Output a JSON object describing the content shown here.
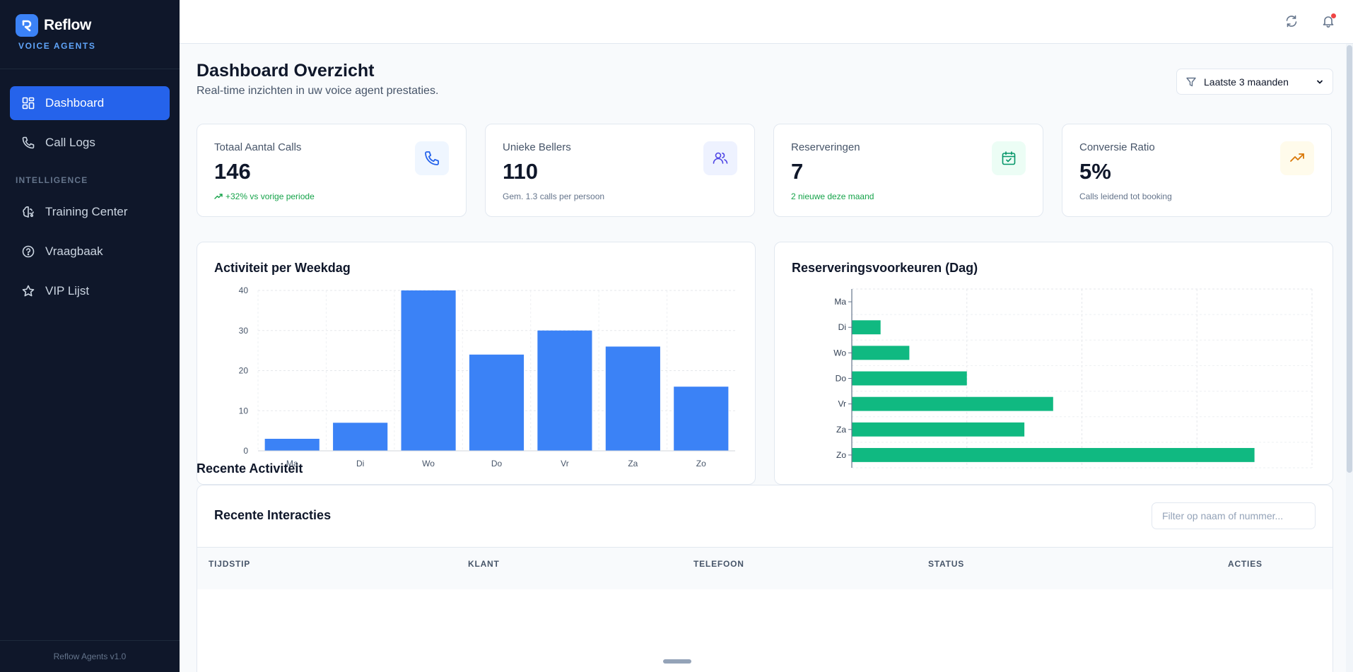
{
  "brand": {
    "name": "Reflow",
    "subtitle": "VOICE AGENTS"
  },
  "sidebar": {
    "items": [
      {
        "label": "Dashboard",
        "icon": "layout-grid-icon",
        "active": true
      },
      {
        "label": "Call Logs",
        "icon": "phone-icon",
        "active": false
      }
    ],
    "section_label": "INTELLIGENCE",
    "intel_items": [
      {
        "label": "Training Center",
        "icon": "brain-icon"
      },
      {
        "label": "Vraagbaak",
        "icon": "help-circle-icon"
      },
      {
        "label": "VIP Lijst",
        "icon": "star-icon"
      }
    ],
    "footer": "Reflow Agents v1.0"
  },
  "topbar": {
    "icons": [
      "refresh-icon",
      "bell-icon"
    ]
  },
  "header": {
    "title": "Dashboard Overzicht",
    "subtitle": "Real-time inzichten in uw voice agent prestaties.",
    "filter_value": "Laatste 3 maanden"
  },
  "stats": [
    {
      "label": "Totaal Aantal Calls",
      "value": "146",
      "note": "+32% vs vorige periode",
      "icon": "phone-icon",
      "color": "#2563eb"
    },
    {
      "label": "Unieke Bellers",
      "value": "110",
      "note": "Gem. 1.3 calls per persoon",
      "icon": "users-icon",
      "color": "#4f46e5"
    },
    {
      "label": "Reserveringen",
      "value": "7",
      "note": "2 nieuwe deze maand",
      "icon": "calendar-check-icon",
      "color": "#059669"
    },
    {
      "label": "Conversie Ratio",
      "value": "5%",
      "note": "Calls leidend tot booking",
      "icon": "trending-up-icon",
      "color": "#d97706"
    }
  ],
  "colors": {
    "accent": "#2563eb",
    "bar_blue": "#3b82f6",
    "bar_green": "#10b981",
    "sidebar_bg": "#0f172a"
  },
  "chart_data": [
    {
      "type": "bar",
      "title": "Activiteit per Weekdag",
      "categories": [
        "Ma",
        "Di",
        "Wo",
        "Do",
        "Vr",
        "Za",
        "Zo"
      ],
      "values": [
        3,
        7,
        40,
        24,
        30,
        26,
        16
      ],
      "yticks": [
        "0",
        "10",
        "20",
        "30",
        "40"
      ],
      "ylim": [
        0,
        40
      ],
      "grid": true
    },
    {
      "type": "bar",
      "orientation": "horizontal",
      "title": "Reserveringsvoorkeuren (Dag)",
      "categories": [
        "Ma",
        "Di",
        "Wo",
        "Do",
        "Vr",
        "Za",
        "Zo"
      ],
      "values": [
        0,
        0.5,
        1,
        2,
        3.5,
        3,
        7
      ],
      "xlim": [
        0,
        8
      ],
      "grid": true
    }
  ],
  "recent": {
    "section_title": "Recente Activiteit",
    "table_title": "Recente Interacties",
    "filter_placeholder": "Filter op naam of nummer...",
    "columns": [
      "TIJDSTIP",
      "KLANT",
      "TELEFOON",
      "STATUS",
      "ACTIES"
    ]
  }
}
